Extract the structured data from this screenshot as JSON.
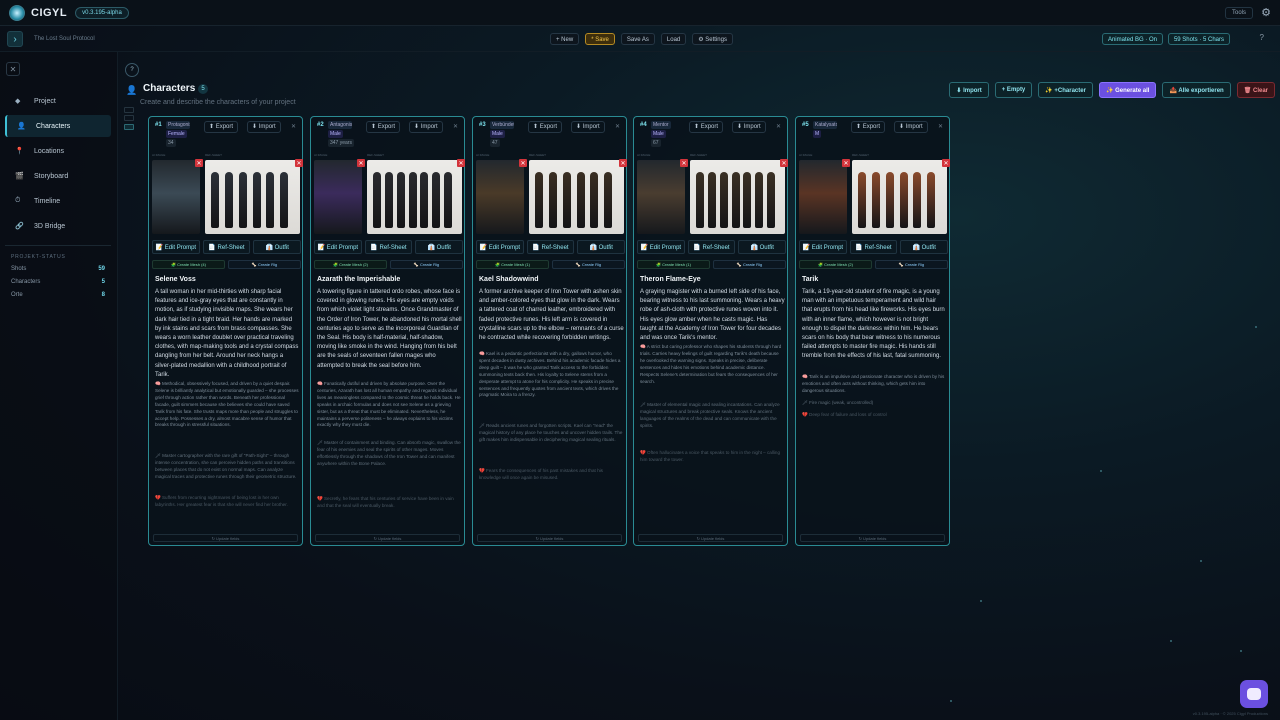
{
  "app": {
    "name": "CIGYL",
    "version": "v0.3.195-alpha",
    "tools": "Tools"
  },
  "subbar": {
    "project": "The Lost Soul Protocol",
    "new": "+ New",
    "save": "* Save",
    "saveas": "Save As",
    "load": "Load",
    "settings": "⚙ Settings",
    "animated": "Animated BG · On",
    "shots": "59 Shots · 5 Chars",
    "help": "?"
  },
  "sidebar": {
    "items": [
      {
        "icon": "◆",
        "label": "Project"
      },
      {
        "icon": "👤",
        "label": "Characters"
      },
      {
        "icon": "📍",
        "label": "Locations"
      },
      {
        "icon": "🎬",
        "label": "Storyboard"
      },
      {
        "icon": "⏱",
        "label": "Timeline"
      },
      {
        "icon": "🔗",
        "label": "3D Bridge"
      }
    ],
    "status_title": "PROJEKT-STATUS",
    "stats": [
      {
        "label": "Shots",
        "value": "59"
      },
      {
        "label": "Characters",
        "value": "5"
      },
      {
        "label": "Orte",
        "value": "8"
      }
    ]
  },
  "page": {
    "title": "Characters",
    "count": "5",
    "subtitle": "Create and describe the characters of your project",
    "help": "?"
  },
  "actions": {
    "import": "⬇ Import",
    "empty": "+ Empty",
    "character": "✨ +Character",
    "generate": "✨ Generate all",
    "export": "📤 Alle exportieren",
    "clear": "🗑 Clear"
  },
  "card_labels": {
    "export": "⬆ Export",
    "import": "⬇ Import",
    "image": "AI IMAGE",
    "ref": "REF-SHEET",
    "edit": "📝 Edit Prompt",
    "refsheet": "📄 Ref-Sheet",
    "outfit": "👔 Outfit",
    "rig": "🦴 Create Rig",
    "update": "↻ Update fields"
  },
  "characters": [
    {
      "num": "#1",
      "role": "Protagonist",
      "gender": "Female",
      "age": "34",
      "mesh": "🧩 Create Mesh (4)",
      "name": "Selene Voss",
      "desc": "A tall woman in her mid-thirties with sharp facial features and ice-gray eyes that are constantly in motion, as if studying invisible maps. She wears her dark hair tied in a tight braid. Her hands are marked by ink stains and scars from brass compasses. She wears a worn leather doublet over practical traveling clothes, with map-making tools and a crystal compass dangling from her belt. Around her neck hangs a silver-plated medallion with a childhood portrait of Tarik.",
      "personality": "🧠 Methodical, obsessively focused, and driven by a quiet despair. Selene is brilliantly analytical but emotionally guarded – she processes grief through action rather than words. Beneath her professional facade, guilt simmers because she believes she could have saved Tarik from his fate. She trusts maps more than people and struggles to accept help. Possesses a dry, almost macabre sense of humor that breaks through in stressful situations.",
      "skills": "🗡 Master cartographer with the rare gift of \"Path-Sight\" – through intense concentration, she can perceive hidden paths and transitions between places that do not exist on normal maps. Can analyze magical traces and protective runes through their geometric structure.",
      "fears": "💔 Suffers from recurring nightmares of being lost in her own labyrinths. Her greatest fear is that she will never find her brother."
    },
    {
      "num": "#2",
      "role": "Antagonist",
      "gender": "Male",
      "age": "347 years",
      "mesh": "🧩 Create Mesh (2)",
      "name": "Azarath the Imperishable",
      "desc": "A towering figure in tattered ordo robes, whose face is covered in glowing runes. His eyes are empty voids from which violet light streams. Once Grandmaster of the Order of Iron Tower, he abandoned his mortal shell centuries ago to serve as the incorporeal Guardian of the Seal. His body is half-material, half-shadow, moving like smoke in the wind. Hanging from his belt are the seals of seventeen fallen mages who attempted to break the seal before him.",
      "personality": "🧠 Fanatically dutiful and driven by absolute purpose. Over the centuries, Azarath has lost all human empathy and regards individual lives as meaningless compared to the cosmic threat he holds back. He speaks in archaic formulas and does not see Selene as a grieving sister, but as a threat that must be eliminated. Nevertheless, he maintains a perverse politeness – he always explains to his victims exactly why they must die.",
      "skills": "🗡 Master of containment and binding. Can absorb magic, swallow the fear of his enemies and seal the spirits of other mages. Moves effortlessly through the shadows of the Iron Tower and can manifest anywhere within the Bone Palace.",
      "fears": "💔 Secretly, he fears that his centuries of service have been in vain and that the seal will eventually break."
    },
    {
      "num": "#3",
      "role": "Verbündeter",
      "gender": "Male",
      "age": "47",
      "mesh": "🧩 Create Mesh (1)",
      "name": "Kael Shadowwind",
      "desc": "A former archive keeper of Iron Tower with ashen skin and amber-colored eyes that glow in the dark. Wears a tattered coat of charred leather, embroidered with faded protective runes. His left arm is covered in crystalline scars up to the elbow – remnants of a curse he contracted while recovering forbidden writings.",
      "personality": "🧠 Kael is a pedantic perfectionist with a dry, gallows humor, who spent decades in dusty archives. Behind his academic facade hides a deep guilt – it was he who granted Tarik access to the forbidden summoning texts back then. His loyalty to Selene stems from a desperate attempt to atone for his complicity. He speaks in precise sentences and frequently quotes from ancient texts, which drives the pragmatic Moira to a frenzy.",
      "skills": "🗡 Reads ancient runes and forgotten scripts. Kael can \"read\" the magical history of any place he touches and uncover hidden trails. The gift makes him indispensable in deciphering magical sealing rituals.",
      "fears": "💔 Fears the consequences of his past mistakes and that his knowledge will once again be misused."
    },
    {
      "num": "#4",
      "role": "Mentor",
      "gender": "Male",
      "age": "67",
      "mesh": "🧩 Create Mesh (1)",
      "name": "Theron Flame-Eye",
      "desc": "A graying magister with a burned left side of his face, bearing witness to his last summoning. Wears a heavy robe of ash-cloth with protective runes woven into it. His eyes glow amber when he casts magic. Has taught at the Academy of Iron Tower for four decades and was once Tarik's mentor.",
      "personality": "🧠 A strict but caring professor who shapes his students through hard trials. Carries heavy feelings of guilt regarding Tarik's death because he overlooked the warning signs. Speaks in precise, deliberate sentences and hides his emotions behind academic distance. Respects Selene's determination but fears the consequences of her search.",
      "skills": "🗡 Master of elemental magic and sealing incantations. Can analyze magical structures and break protective seals. Knows the ancient languages of the realms of the dead and can communicate with the spirits.",
      "fears": "💔 Often hallucinates a voice that speaks to him in the night – calling him toward the tower."
    },
    {
      "num": "#5",
      "role": "Katalysator",
      "gender": "M",
      "age": "",
      "mesh": "🧩 Create Mesh (2)",
      "name": "Tarik",
      "desc": "Tarik, a 19-year-old student of fire magic, is a young man with an impetuous temperament and wild hair that erupts from his head like fireworks. His eyes burn with an inner flame, which however is not bright enough to dispel the darkness within him. He bears scars on his body that bear witness to his numerous failed attempts to master fire magic. His hands still tremble from the effects of his last, fatal summoning.",
      "personality": "🧠 Tarik is an impulsive and passionate character who is driven by his emotions and often acts without thinking, which gets him into dangerous situations.",
      "skills": "🗡 Fire magic (weak, uncontrolled)",
      "fears": "💔 Deep fear of failure and loss of control"
    }
  ],
  "chat": "assistant",
  "footer": "v0.3.195-alpha · © 2025 Cigyl Productions"
}
